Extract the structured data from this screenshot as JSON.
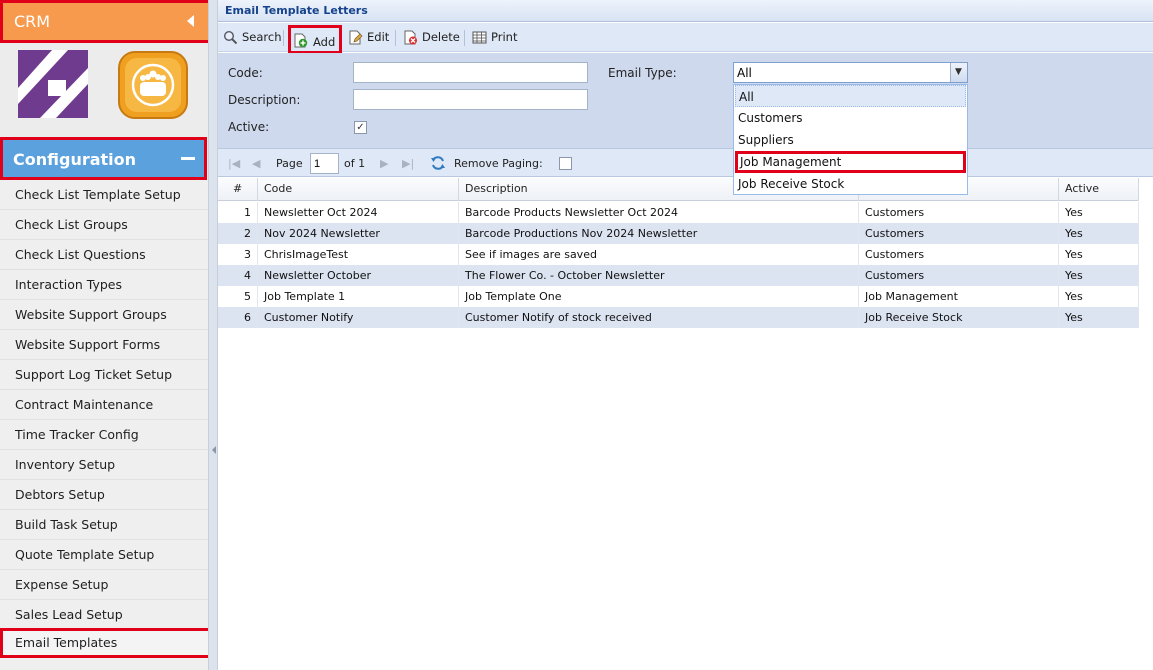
{
  "sidebar": {
    "crm_title": "CRM",
    "config_title": "Configuration",
    "items": [
      {
        "label": "Check List Template Setup"
      },
      {
        "label": "Check List Groups"
      },
      {
        "label": "Check List Questions"
      },
      {
        "label": "Interaction Types"
      },
      {
        "label": "Website Support Groups"
      },
      {
        "label": "Website Support Forms"
      },
      {
        "label": "Support Log Ticket Setup"
      },
      {
        "label": "Contract Maintenance"
      },
      {
        "label": "Time Tracker Config"
      },
      {
        "label": "Inventory Setup"
      },
      {
        "label": "Debtors Setup"
      },
      {
        "label": "Build Task Setup"
      },
      {
        "label": "Quote Template Setup"
      },
      {
        "label": "Expense Setup"
      },
      {
        "label": "Sales Lead Setup"
      },
      {
        "label": "Email Templates",
        "selected": true
      }
    ]
  },
  "panel": {
    "title": "Email Template Letters"
  },
  "toolbar": {
    "search_label": "Search",
    "add_label": "Add",
    "edit_label": "Edit",
    "delete_label": "Delete",
    "print_label": "Print"
  },
  "form": {
    "code_label": "Code:",
    "code_value": "",
    "description_label": "Description:",
    "description_value": "",
    "active_label": "Active:",
    "active_checked": true,
    "email_type_label": "Email Type:",
    "email_type_value": "All",
    "email_type_options": [
      "All",
      "Customers",
      "Suppliers",
      "Job Management",
      "Job Receive Stock"
    ],
    "email_type_highlighted": "Job Management"
  },
  "paging": {
    "page_label": "Page",
    "page_value": "1",
    "of_label": "of 1",
    "remove_paging_label": "Remove Paging:",
    "remove_paging_checked": false
  },
  "grid": {
    "headers": {
      "num": "#",
      "code": "Code",
      "description": "Description",
      "email_type": "",
      "active": "Active"
    },
    "rows": [
      {
        "num": "1",
        "code": "Newsletter Oct 2024",
        "description": "Barcode Products Newsletter Oct 2024",
        "email_type": "Customers",
        "active": "Yes"
      },
      {
        "num": "2",
        "code": "Nov 2024 Newsletter",
        "description": "Barcode Productions Nov 2024 Newsletter",
        "email_type": "Customers",
        "active": "Yes"
      },
      {
        "num": "3",
        "code": "ChrisImageTest",
        "description": "See if images are saved",
        "email_type": "Customers",
        "active": "Yes"
      },
      {
        "num": "4",
        "code": "Newsletter October",
        "description": "The Flower Co. - October Newsletter",
        "email_type": "Customers",
        "active": "Yes"
      },
      {
        "num": "5",
        "code": "Job Template 1",
        "description": "Job Template One",
        "email_type": "Job Management",
        "active": "Yes"
      },
      {
        "num": "6",
        "code": "Customer Notify",
        "description": "Customer Notify of stock received",
        "email_type": "Job Receive Stock",
        "active": "Yes"
      }
    ]
  },
  "colors": {
    "crm_header": "#f79a4d",
    "config_header": "#5aa1de",
    "highlight_box": "#e0001a",
    "title_text": "#15428b",
    "row_alt": "#dce3f1"
  },
  "icons": {
    "crm_collapse": "triangle-left-icon",
    "config_collapse": "minus-icon",
    "search": "magnifier-icon",
    "add": "add-document-icon",
    "edit": "edit-document-icon",
    "delete": "delete-document-icon",
    "print": "print-grid-icon",
    "refresh": "refresh-icon"
  }
}
